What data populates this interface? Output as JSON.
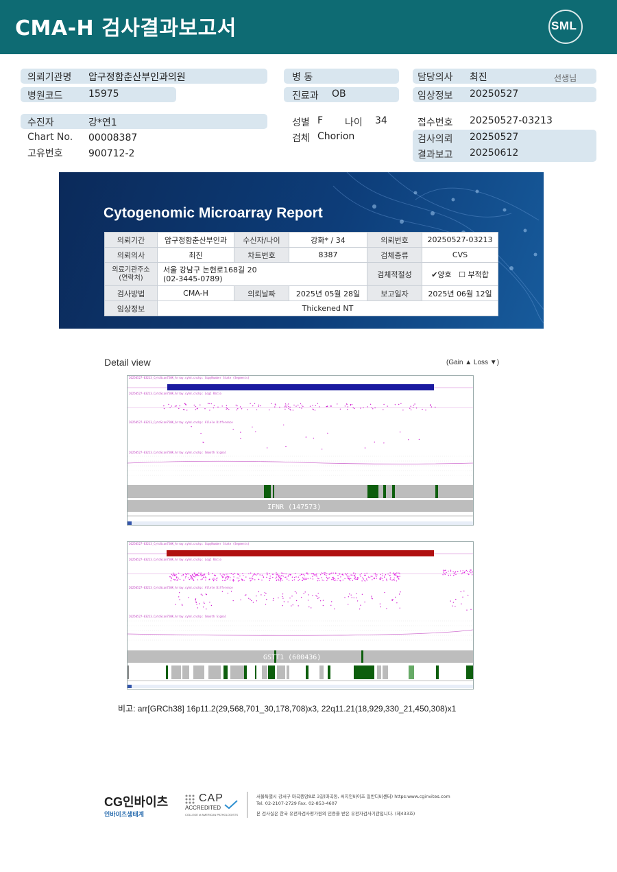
{
  "header": {
    "title": "CMA-H 검사결과보고서",
    "logo_text": "SML"
  },
  "info": {
    "hospital_label": "의뢰기관명",
    "hospital_value": "압구정함춘산부인과의원",
    "code_label": "병원코드",
    "code_value": "15975",
    "patient_label": "수진자",
    "patient_value": "강*연1",
    "chart_label": "Chart No.",
    "chart_value": "00008387",
    "id_label": "고유번호",
    "id_value": "900712-2",
    "ward_label": "병 동",
    "ward_value": "",
    "dept_label": "진료과",
    "dept_value": "OB",
    "sex_label": "성별",
    "sex_value": "F",
    "age_label": "나이",
    "age_value": "34",
    "specimen_label": "검체",
    "specimen_value": "Chorion",
    "doctor_label": "담당의사",
    "doctor_value": "최진",
    "doctor_suffix": "선생님",
    "clinical_label": "임상정보",
    "clinical_value": "20250527",
    "accession_label": "접수번호",
    "accession_value": "20250527-03213",
    "request_label": "검사의뢰",
    "request_value": "20250527",
    "report_label": "결과보고",
    "report_value": "20250612"
  },
  "report": {
    "title": "Cytogenomic Microarray Report",
    "r1": {
      "c1": "의뢰기간",
      "c2": "압구정함춘산부인과",
      "c3": "수신자/나이",
      "c4": "강화* / 34",
      "c5": "의뢰번호",
      "c6": "20250527-03213"
    },
    "r2": {
      "c1": "의뢰의사",
      "c2": "최진",
      "c3": "차트번호",
      "c4": "8387",
      "c5": "검체종류",
      "c6": "CVS"
    },
    "r3": {
      "c1a": "의료기관주소",
      "c1b": "(연락처)",
      "c2a": "서울 강남구 논현로168길 20",
      "c2b": "(02-3445-0789)",
      "c5": "검체적절성",
      "check_ok": "✔양호",
      "check_bad": "☐ 부적합"
    },
    "r4": {
      "c1": "검사방법",
      "c2": "CMA-H",
      "c3": "의뢰날짜",
      "c4": "2025년 05월 28일",
      "c5": "보고일자",
      "c6": "2025년 06월 12일"
    },
    "r5": {
      "c1": "임상정보",
      "c2": "Thickened NT"
    }
  },
  "detail": {
    "title": "Detail view",
    "gain_loss": "(Gain ▲  Loss ▼)",
    "gain_color": "#1a1aa0",
    "loss_color": "#b01010",
    "plot1_gene": "IFNR (147573)",
    "plot2_gene": "GSTT1 (600436)"
  },
  "remark": "비고: arr[GRCh38] 16p11.2(29,568,701_30,178,708)x3, 22q11.21(18,929,330_21,450,308)x1",
  "footer": {
    "brand": "CG인바이츠",
    "brand_sub": "인바이츠생태계",
    "cap": "CAP",
    "cap_accredited": "ACCREDITED",
    "cap_sub": "COLLEGE of AMERICAN PATHOLOGISTS",
    "address": "서울특별시 강서구 마곡중앙8로 3길(마곡동, 씨지인바이츠 일반디비센터)  https:www.cginvites.com",
    "tel": "Tel. 02-2107-2729   Fax. 02-853-4607",
    "notice": "본 검사실은 한국 유전자검사평가원의 인증을 받은 유전자검사기관입니다. (제433호)"
  }
}
